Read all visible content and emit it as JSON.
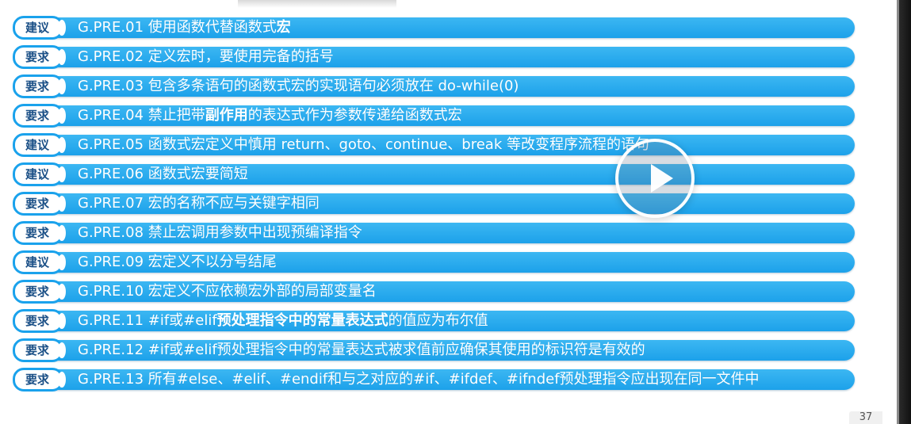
{
  "rules": [
    {
      "badge": "建议",
      "text_prefix": "G.PRE.01 使用函数代替函数式",
      "text_bold": "宏",
      "text_suffix": ""
    },
    {
      "badge": "要求",
      "text_prefix": "G.PRE.02 定义宏时，要使用完备的括号",
      "text_bold": "",
      "text_suffix": ""
    },
    {
      "badge": "要求",
      "text_prefix": "G.PRE.03 包含多条语句的函数式宏的实现语句必须放在 do-while(0)",
      "text_bold": "",
      "text_suffix": ""
    },
    {
      "badge": "要求",
      "text_prefix": "G.PRE.04 禁止把带",
      "text_bold": "副作用",
      "text_suffix": "的表达式作为参数传递给函数式宏"
    },
    {
      "badge": "建议",
      "text_prefix": "G.PRE.05 函数式宏定义中慎用 return、goto、continue、break 等改变程序流程的语句",
      "text_bold": "",
      "text_suffix": ""
    },
    {
      "badge": "建议",
      "text_prefix": "G.PRE.06 函数式宏要简短",
      "text_bold": "",
      "text_suffix": ""
    },
    {
      "badge": "要求",
      "text_prefix": "G.PRE.07 宏的名称不应与关键字相同",
      "text_bold": "",
      "text_suffix": ""
    },
    {
      "badge": "要求",
      "text_prefix": "G.PRE.08 禁止宏调用参数中出现预编译指令",
      "text_bold": "",
      "text_suffix": ""
    },
    {
      "badge": "建议",
      "text_prefix": "G.PRE.09 宏定义不以分号结尾",
      "text_bold": "",
      "text_suffix": ""
    },
    {
      "badge": "要求",
      "text_prefix": "G.PRE.10 宏定义不应依赖宏外部的局部变量名",
      "text_bold": "",
      "text_suffix": ""
    },
    {
      "badge": "要求",
      "text_prefix": "G.PRE.11 #if或#elif",
      "text_bold": "预处理指令中的常量表达式",
      "text_suffix": "的值应为布尔值"
    },
    {
      "badge": "要求",
      "text_prefix": "G.PRE.12 #if或#elif预处理指令中的常量表达式被求值前应确保其使用的标识符是有效的",
      "text_bold": "",
      "text_suffix": ""
    },
    {
      "badge": "要求",
      "text_prefix": "G.PRE.13 所有#else、#elif、#endif和与之对应的#if、#ifdef、#ifndef预处理指令应出现在同一文件中",
      "text_bold": "",
      "text_suffix": ""
    }
  ],
  "overlay": {
    "play_icon": "play-icon"
  },
  "footer": {
    "page_number": "37"
  },
  "colors": {
    "bar_blue": "#1ca1ea",
    "badge_text": "#1a4f86",
    "text_white": "#ffffff"
  }
}
